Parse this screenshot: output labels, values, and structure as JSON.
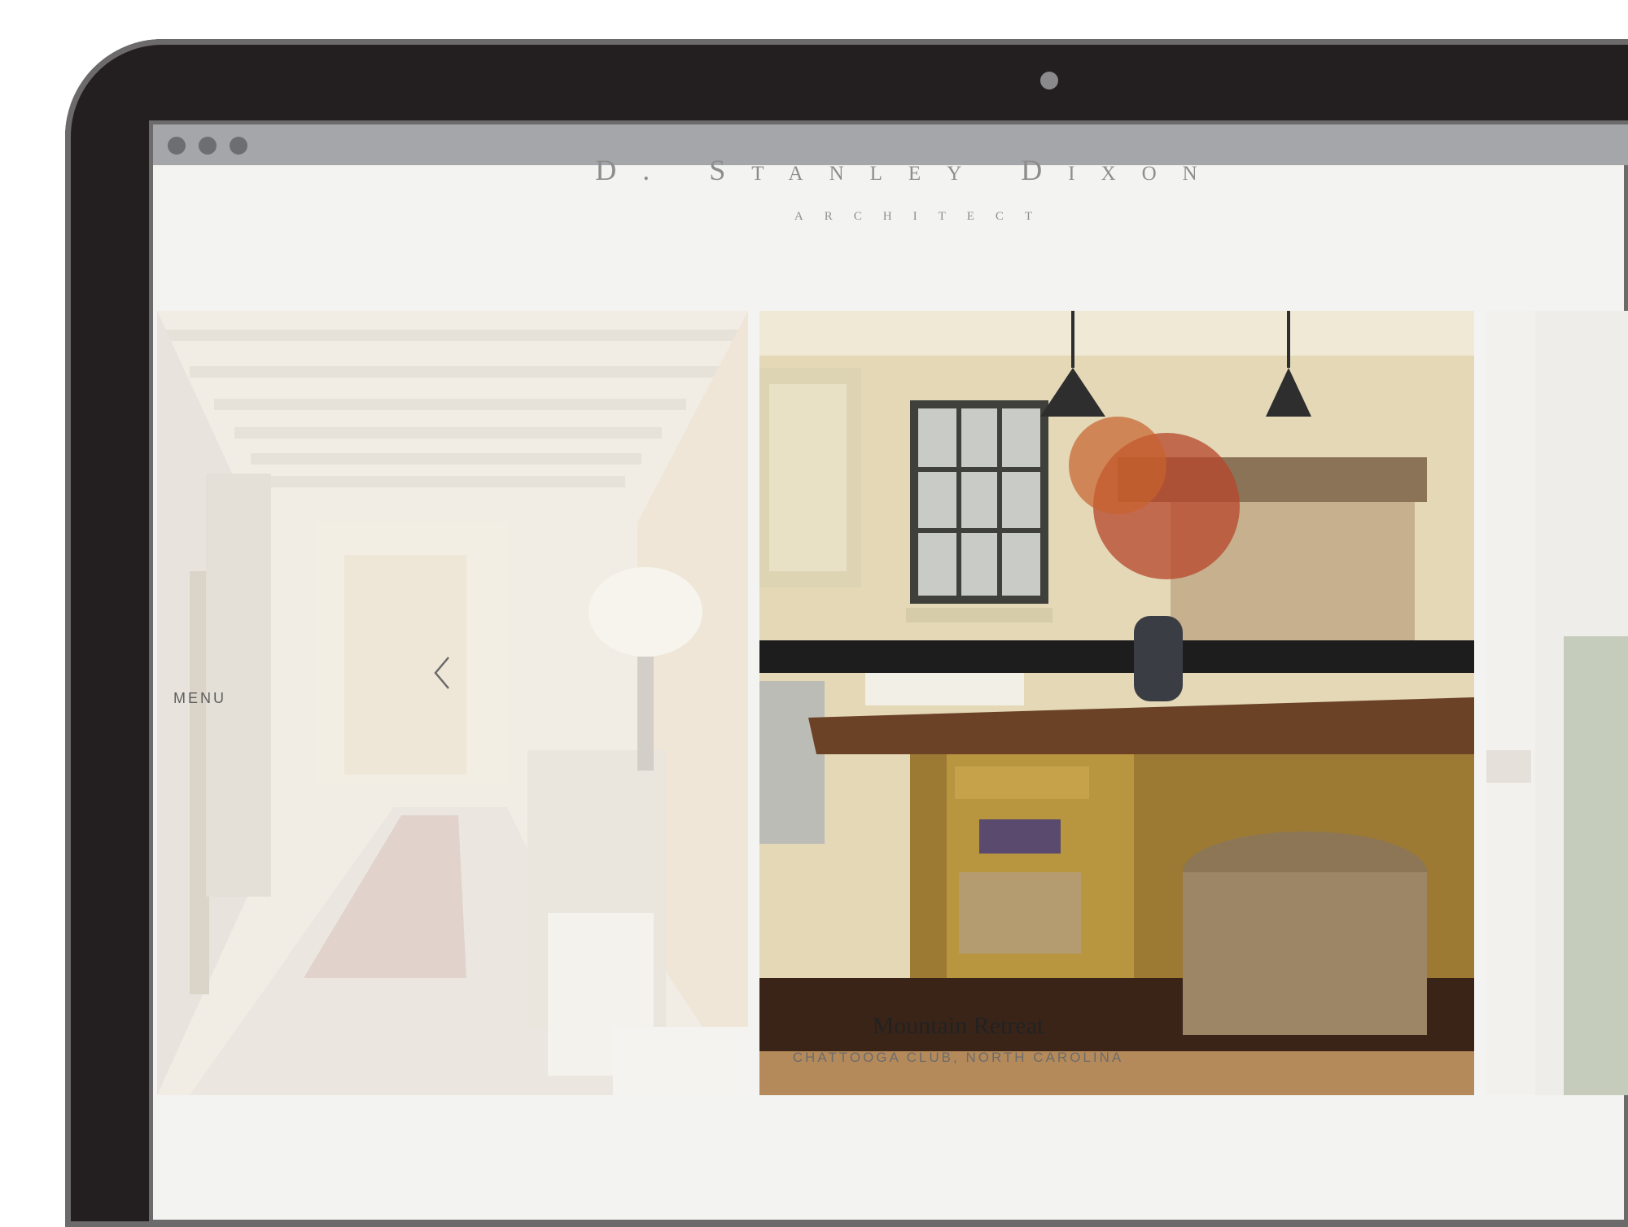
{
  "brand": {
    "name": "D. Stanley Dixon",
    "tagline": "ARCHITECT"
  },
  "nav": {
    "menu_label": "MENU",
    "prev_icon": "chevron-left-icon"
  },
  "slides": [
    {
      "description": "",
      "state": "inactive"
    },
    {
      "description": "",
      "state": "active"
    },
    {
      "description": "",
      "state": "inactive"
    }
  ],
  "caption": {
    "title": "Mountain Retreat",
    "location": "CHATTOOGA CLUB, NORTH CAROLINA"
  },
  "colors": {
    "bezel": "#231f20",
    "page_background": "#f3f3f1",
    "titlebar": "#a5a6a9",
    "brand_text": "#8d8d8d"
  }
}
